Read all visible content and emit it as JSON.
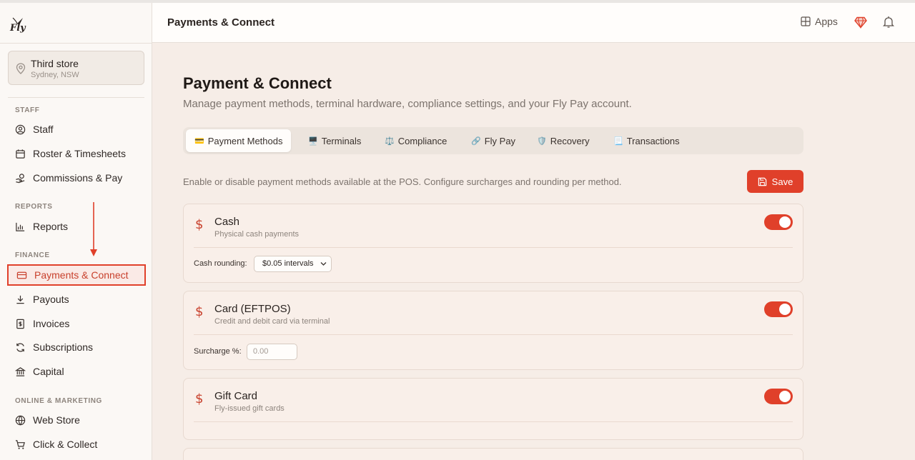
{
  "brand": {
    "logo_text": "Fly"
  },
  "store": {
    "name": "Third store",
    "location": "Sydney, NSW"
  },
  "sidebar": {
    "sections": [
      {
        "title": "STAFF",
        "items": [
          "Staff",
          "Roster & Timesheets",
          "Commissions & Pay"
        ]
      },
      {
        "title": "REPORTS",
        "items": [
          "Reports"
        ]
      },
      {
        "title": "FINANCE",
        "items": [
          "Payments & Connect",
          "Payouts",
          "Invoices",
          "Subscriptions",
          "Capital"
        ]
      },
      {
        "title": "ONLINE & MARKETING",
        "items": [
          "Web Store",
          "Click & Collect"
        ]
      }
    ],
    "active_item": "Payments & Connect"
  },
  "header": {
    "title": "Payments & Connect",
    "apps_label": "Apps"
  },
  "page": {
    "title": "Payment & Connect",
    "subtitle": "Manage payment methods, terminal hardware, compliance settings, and your Fly Pay account."
  },
  "tabs": [
    {
      "label": "Payment Methods",
      "icon": "💳",
      "active": true
    },
    {
      "label": "Terminals",
      "icon": "🖥️",
      "active": false
    },
    {
      "label": "Compliance",
      "icon": "⚖️",
      "active": false
    },
    {
      "label": "Fly Pay",
      "icon": "🔗",
      "active": false
    },
    {
      "label": "Recovery",
      "icon": "🛡️",
      "active": false
    },
    {
      "label": "Transactions",
      "icon": "📃",
      "active": false
    }
  ],
  "methods_description": "Enable or disable payment methods available at the POS. Configure surcharges and rounding per method.",
  "save_label": "Save",
  "methods": [
    {
      "name": "Cash",
      "description": "Physical cash payments",
      "enabled": true,
      "field_label": "Cash rounding:",
      "field_value": "$0.05 intervals",
      "field_type": "select"
    },
    {
      "name": "Card (EFTPOS)",
      "description": "Credit and debit card via terminal",
      "enabled": true,
      "field_label": "Surcharge %:",
      "field_placeholder": "0.00",
      "field_type": "input"
    },
    {
      "name": "Gift Card",
      "description": "Fly-issued gift cards",
      "enabled": true
    }
  ],
  "colors": {
    "accent": "#e0402a",
    "background": "#f6ede7",
    "sidebar": "#fbf8f5"
  }
}
